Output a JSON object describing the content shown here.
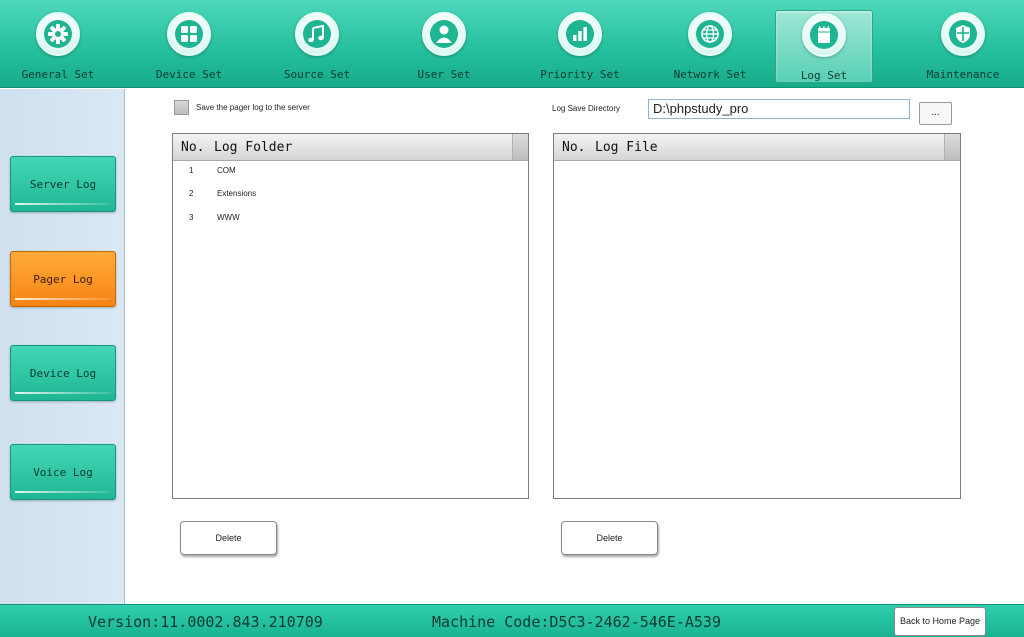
{
  "nav": {
    "tabs": [
      {
        "label": "General Set",
        "icon": "gear-icon",
        "active": false
      },
      {
        "label": "Device Set",
        "icon": "grid-icon",
        "active": false
      },
      {
        "label": "Source Set",
        "icon": "music-note-icon",
        "active": false
      },
      {
        "label": "User Set",
        "icon": "user-icon",
        "active": false
      },
      {
        "label": "Priority Set",
        "icon": "bar-chart-icon",
        "active": false
      },
      {
        "label": "Network Set",
        "icon": "globe-icon",
        "active": false
      },
      {
        "label": "Log Set",
        "icon": "notepad-icon",
        "active": true
      },
      {
        "label": "Maintenance",
        "icon": "shield-icon",
        "active": false
      }
    ]
  },
  "sidebar": {
    "items": [
      {
        "label": "Server Log",
        "active": false
      },
      {
        "label": "Pager Log",
        "active": true
      },
      {
        "label": "Device Log",
        "active": false
      },
      {
        "label": "Voice Log",
        "active": false
      }
    ]
  },
  "main": {
    "save_checkbox_label": "Save the pager log to the server",
    "save_checkbox_checked": false,
    "directory_label": "Log Save Directory",
    "directory_value": "D:\\phpstudy_pro",
    "browse_label": "...",
    "folder_table": {
      "col_no": "No.",
      "col_title": "Log Folder",
      "rows": [
        {
          "no": "1",
          "name": "COM"
        },
        {
          "no": "2",
          "name": "Extensions"
        },
        {
          "no": "3",
          "name": "WWW"
        }
      ]
    },
    "file_table": {
      "col_no": "No.",
      "col_title": "Log File",
      "rows": []
    },
    "delete_folder_label": "Delete",
    "delete_file_label": "Delete"
  },
  "footer": {
    "version": "Version:11.0002.843.210709",
    "machine_code": "Machine Code:D5C3-2462-546E-A539",
    "home_button": "Back to Home Page"
  },
  "colors": {
    "accent_teal": "#26c19e",
    "active_orange": "#f58412",
    "sidebar_bg": "#cfe0ef"
  }
}
